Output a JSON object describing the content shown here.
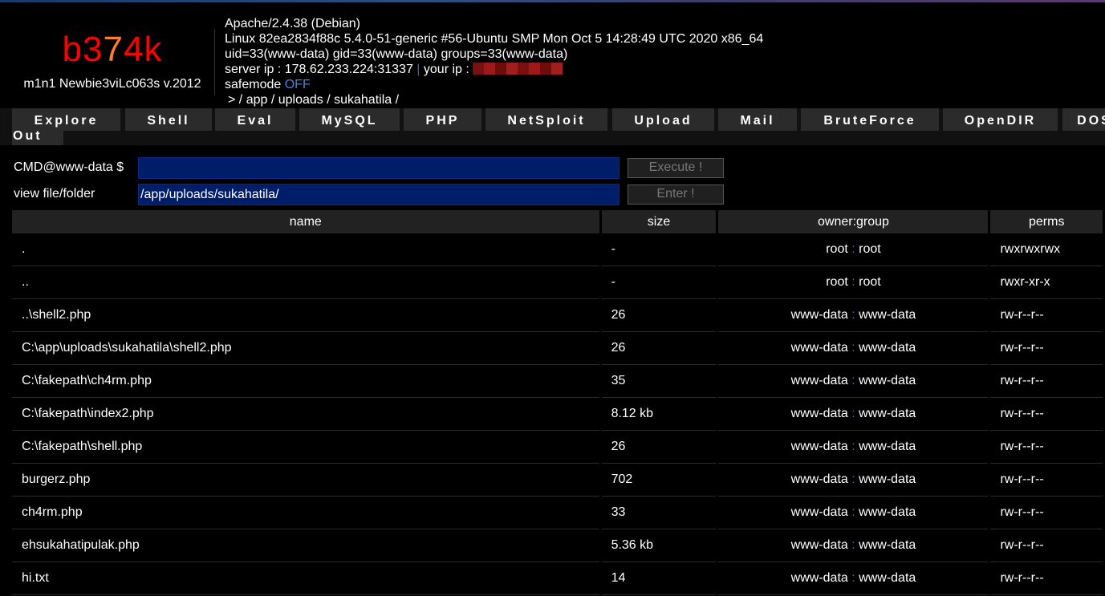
{
  "header": {
    "logo": {
      "part1": "b3",
      "part2": "7",
      "part3": "4k"
    },
    "subtitle": "m1n1 Newbie3viLc063s v.2012",
    "server_software": "Apache/2.4.38 (Debian)",
    "uname": "Linux 82ea2834f88c 5.4.0-51-generic #56-Ubuntu SMP Mon Oct 5 14:28:49 UTC 2020 x86_64",
    "uid": "uid=33(www-data) gid=33(www-data) groups=33(www-data)",
    "server_ip_label": "server ip : 178.62.233.224:31337",
    "separator": "|",
    "your_ip_label": "your ip :",
    "safemode_label": "safemode",
    "safemode_value": "OFF",
    "path_prefix": ">",
    "path": "/ app / uploads / sukahatila /"
  },
  "menu": {
    "items": [
      "Explore",
      "Shell",
      "Eval",
      "MySQL",
      "PHP",
      "NetSploit",
      "Upload",
      "Mail",
      "BruteForce",
      "OpenDIR",
      "DOS"
    ],
    "out": "Out"
  },
  "cmd": {
    "label": "CMD@www-data $",
    "value": "",
    "button": "Execute !"
  },
  "view": {
    "label": "view file/folder",
    "value": "/app/uploads/sukahatila/",
    "button": "Enter !"
  },
  "table": {
    "headers": {
      "name": "name",
      "size": "size",
      "owner": "owner:group",
      "perms": "perms"
    },
    "rows": [
      {
        "name": ".",
        "size": "-",
        "owner": "root",
        "group": "root",
        "perms": "rwxrwxrwx"
      },
      {
        "name": "..",
        "size": "-",
        "owner": "root",
        "group": "root",
        "perms": "rwxr-xr-x"
      },
      {
        "name": "..\\shell2.php",
        "size": "26",
        "owner": "www-data",
        "group": "www-data",
        "perms": "rw-r--r--"
      },
      {
        "name": "C:\\app\\uploads\\sukahatila\\shell2.php",
        "size": "26",
        "owner": "www-data",
        "group": "www-data",
        "perms": "rw-r--r--"
      },
      {
        "name": "C:\\fakepath\\ch4rm.php",
        "size": "35",
        "owner": "www-data",
        "group": "www-data",
        "perms": "rw-r--r--"
      },
      {
        "name": "C:\\fakepath\\index2.php",
        "size": "8.12 kb",
        "owner": "www-data",
        "group": "www-data",
        "perms": "rw-r--r--"
      },
      {
        "name": "C:\\fakepath\\shell.php",
        "size": "26",
        "owner": "www-data",
        "group": "www-data",
        "perms": "rw-r--r--"
      },
      {
        "name": "burgerz.php",
        "size": "702",
        "owner": "www-data",
        "group": "www-data",
        "perms": "rw-r--r--"
      },
      {
        "name": "ch4rm.php",
        "size": "33",
        "owner": "www-data",
        "group": "www-data",
        "perms": "rw-r--r--"
      },
      {
        "name": "ehsukahatipulak.php",
        "size": "5.36 kb",
        "owner": "www-data",
        "group": "www-data",
        "perms": "rw-r--r--"
      },
      {
        "name": "hi.txt",
        "size": "14",
        "owner": "www-data",
        "group": "www-data",
        "perms": "rw-r--r--"
      }
    ]
  }
}
